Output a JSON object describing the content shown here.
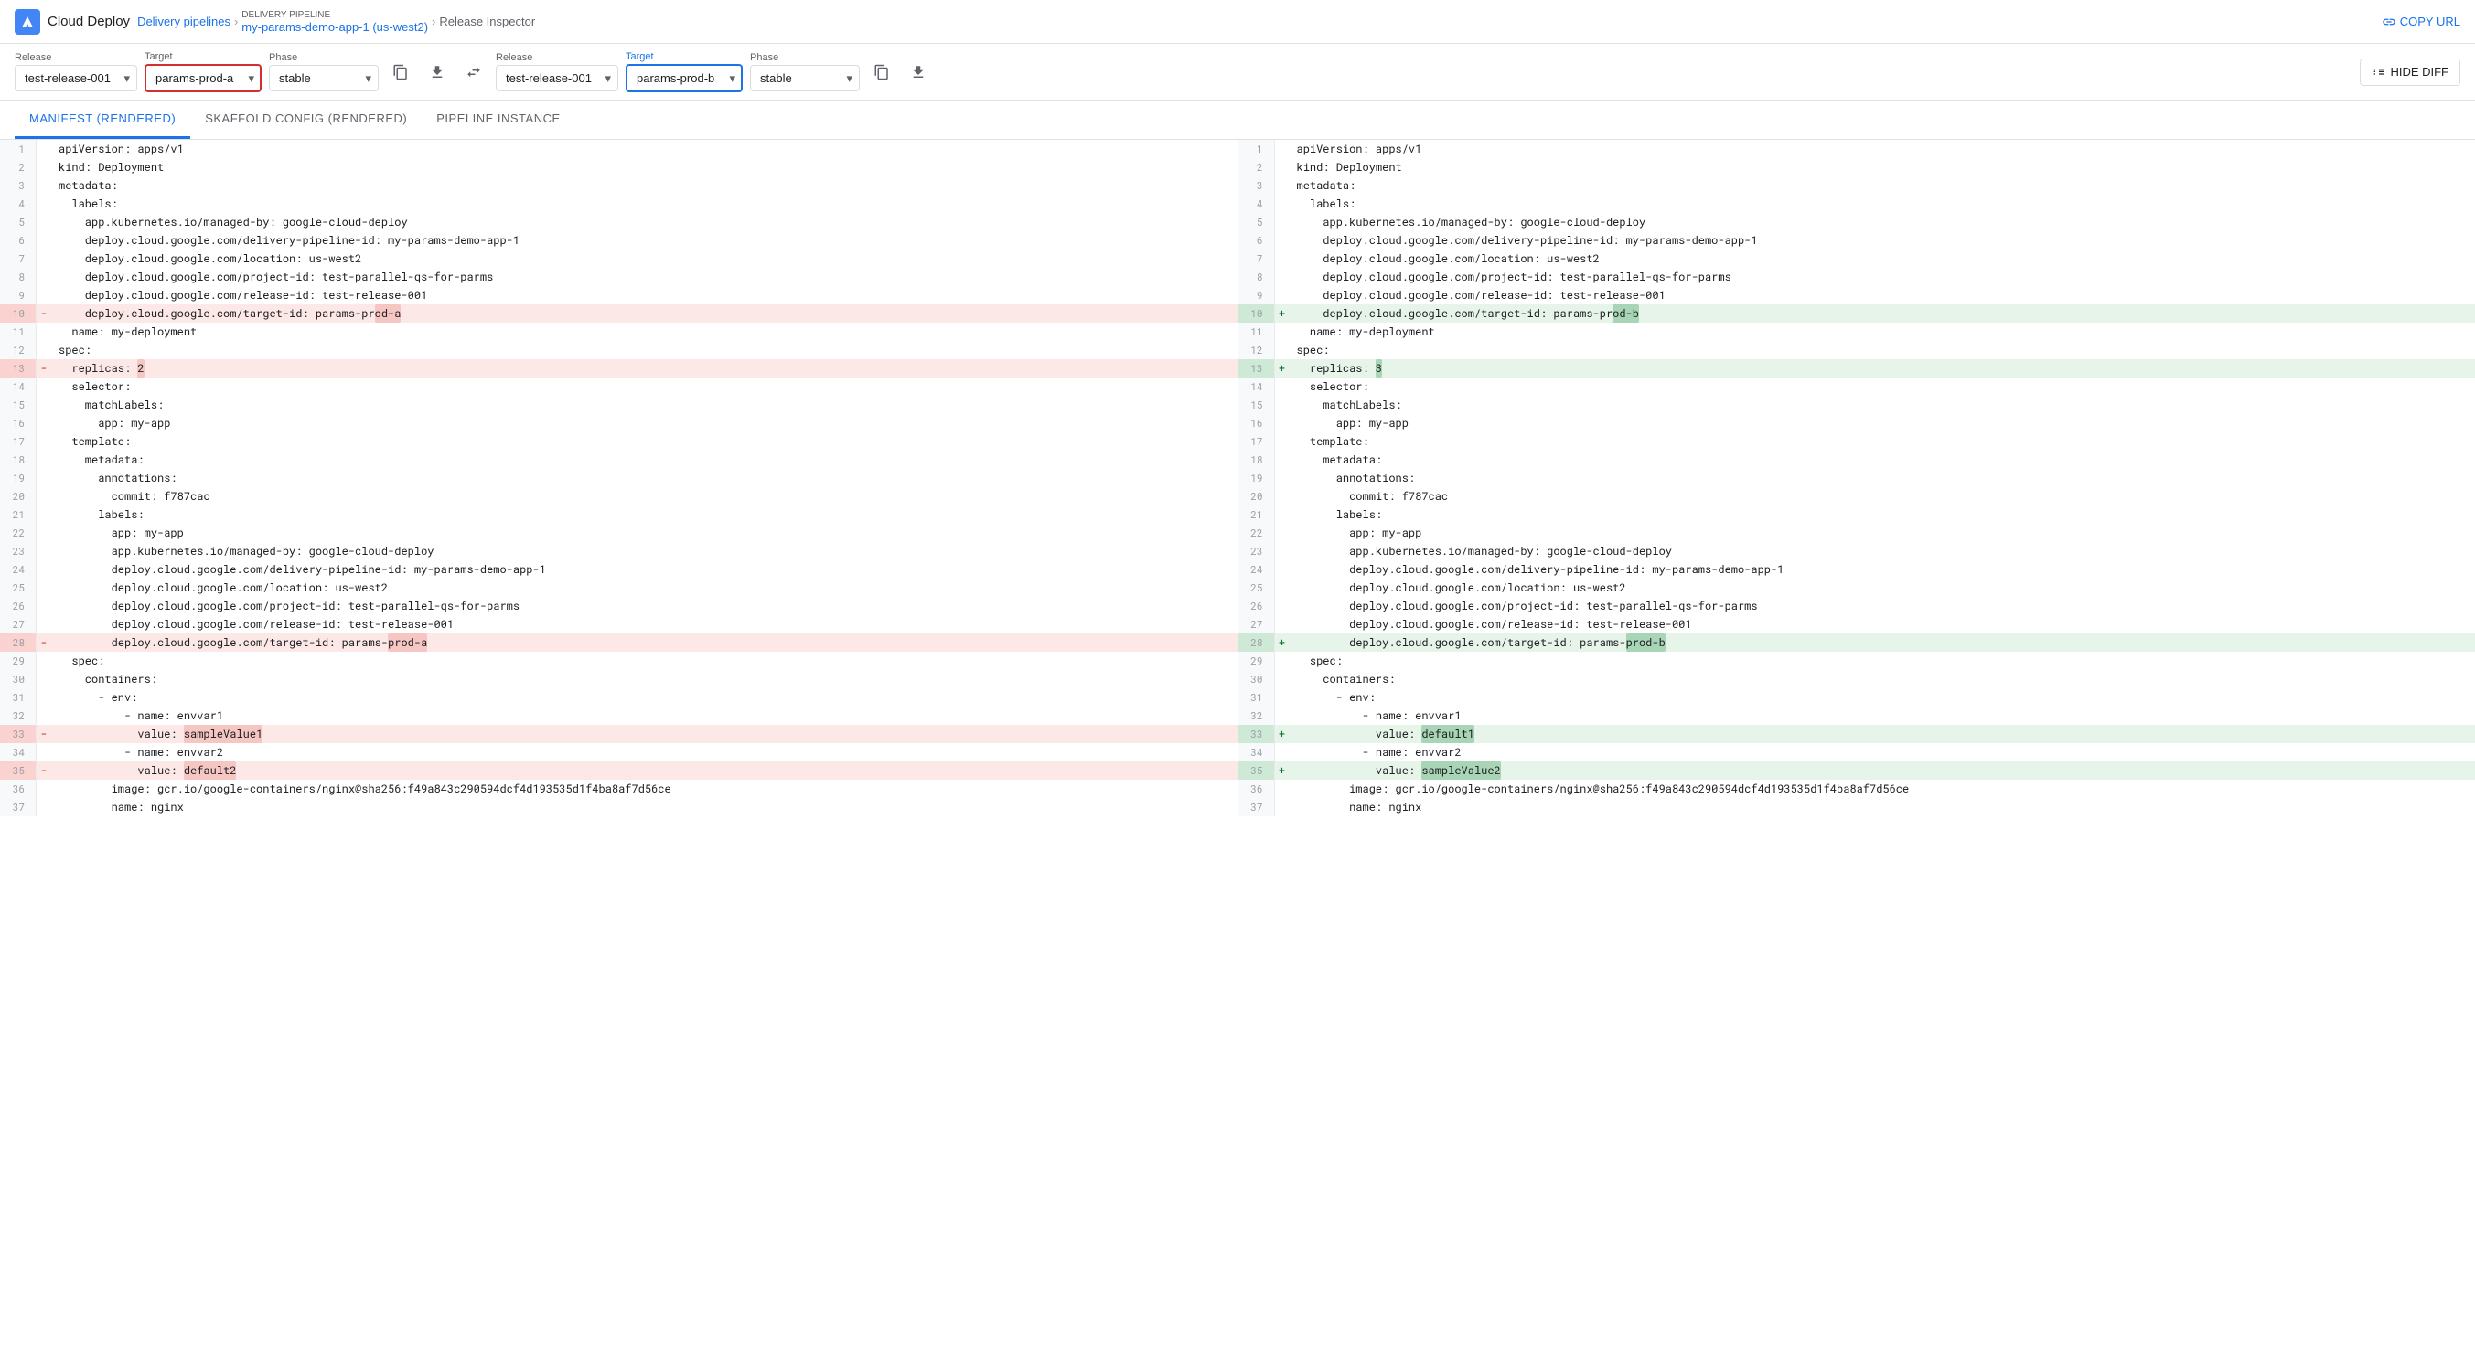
{
  "nav": {
    "logo_text": "Cloud Deploy",
    "breadcrumb": {
      "delivery_pipelines_label": "Delivery pipelines",
      "sep1": ">",
      "pipeline_meta_label": "DELIVERY PIPELINE",
      "pipeline_name": "my-params-demo-app-1 (us-west2)",
      "sep2": ">",
      "current": "Release Inspector"
    },
    "copy_url_label": "COPY URL"
  },
  "toolbar": {
    "left": {
      "release_label": "Release",
      "release_value": "test-release-001",
      "target_label": "Target",
      "target_value": "params-prod-a",
      "phase_label": "Phase",
      "phase_value": "stable"
    },
    "right": {
      "release_label": "Release",
      "release_value": "test-release-001",
      "target_label": "Target",
      "target_value": "params-prod-b",
      "phase_label": "Phase",
      "phase_value": "stable"
    },
    "hide_diff_label": "HIDE DIFF"
  },
  "tabs": [
    {
      "id": "manifest",
      "label": "MANIFEST (RENDERED)",
      "active": true
    },
    {
      "id": "skaffold",
      "label": "SKAFFOLD CONFIG (RENDERED)",
      "active": false
    },
    {
      "id": "pipeline",
      "label": "PIPELINE INSTANCE",
      "active": false
    }
  ],
  "left_lines": [
    {
      "num": 1,
      "type": "normal",
      "content": "apiVersion: apps/v1"
    },
    {
      "num": 2,
      "type": "normal",
      "content": "kind: Deployment"
    },
    {
      "num": 3,
      "type": "normal",
      "content": "metadata:"
    },
    {
      "num": 4,
      "type": "normal",
      "content": "  labels:"
    },
    {
      "num": 5,
      "type": "normal",
      "content": "    app.kubernetes.io/managed-by: google-cloud-deploy"
    },
    {
      "num": 6,
      "type": "normal",
      "content": "    deploy.cloud.google.com/delivery-pipeline-id: my-params-demo-app-1"
    },
    {
      "num": 7,
      "type": "normal",
      "content": "    deploy.cloud.google.com/location: us-west2"
    },
    {
      "num": 8,
      "type": "normal",
      "content": "    deploy.cloud.google.com/project-id: test-parallel-qs-for-parms"
    },
    {
      "num": 9,
      "type": "normal",
      "content": "    deploy.cloud.google.com/release-id: test-release-001"
    },
    {
      "num": 10,
      "type": "removed",
      "marker": "-",
      "content": "    deploy.cloud.google.com/target-id: params-prod-a",
      "highlight_start": 48,
      "highlight_end": 62
    },
    {
      "num": 11,
      "type": "normal",
      "content": "  name: my-deployment"
    },
    {
      "num": 12,
      "type": "normal",
      "content": "spec:"
    },
    {
      "num": 13,
      "type": "removed",
      "marker": "-",
      "content": "  replicas: 2",
      "highlight_start": 12,
      "highlight_end": 13
    },
    {
      "num": 14,
      "type": "normal",
      "content": "  selector:"
    },
    {
      "num": 15,
      "type": "normal",
      "content": "    matchLabels:"
    },
    {
      "num": 16,
      "type": "normal",
      "content": "      app: my-app"
    },
    {
      "num": 17,
      "type": "normal",
      "content": "  template:"
    },
    {
      "num": 18,
      "type": "normal",
      "content": "    metadata:"
    },
    {
      "num": 19,
      "type": "normal",
      "content": "      annotations:"
    },
    {
      "num": 20,
      "type": "normal",
      "content": "        commit: f787cac"
    },
    {
      "num": 21,
      "type": "normal",
      "content": "      labels:"
    },
    {
      "num": 22,
      "type": "normal",
      "content": "        app: my-app"
    },
    {
      "num": 23,
      "type": "normal",
      "content": "        app.kubernetes.io/managed-by: google-cloud-deploy"
    },
    {
      "num": 24,
      "type": "normal",
      "content": "        deploy.cloud.google.com/delivery-pipeline-id: my-params-demo-app-1"
    },
    {
      "num": 25,
      "type": "normal",
      "content": "        deploy.cloud.google.com/location: us-west2"
    },
    {
      "num": 26,
      "type": "normal",
      "content": "        deploy.cloud.google.com/project-id: test-parallel-qs-for-parms"
    },
    {
      "num": 27,
      "type": "normal",
      "content": "        deploy.cloud.google.com/release-id: test-release-001"
    },
    {
      "num": 28,
      "type": "removed",
      "marker": "-",
      "content": "        deploy.cloud.google.com/target-id: params-prod-a",
      "highlight_start": 50,
      "highlight_end": 62
    },
    {
      "num": 29,
      "type": "normal",
      "content": "  spec:"
    },
    {
      "num": 30,
      "type": "normal",
      "content": "    containers:"
    },
    {
      "num": 31,
      "type": "normal",
      "content": "      - env:"
    },
    {
      "num": 32,
      "type": "normal",
      "content": "          - name: envvar1"
    },
    {
      "num": 33,
      "type": "removed",
      "marker": "-",
      "content": "            value: sampleValue1",
      "highlight_start": 19,
      "highlight_end": 31
    },
    {
      "num": 34,
      "type": "normal",
      "content": "          - name: envvar2"
    },
    {
      "num": 35,
      "type": "removed",
      "marker": "-",
      "content": "            value: default2",
      "highlight_start": 19,
      "highlight_end": 27
    },
    {
      "num": 36,
      "type": "normal",
      "content": "        image: gcr.io/google-containers/nginx@sha256:f49a843c290594dcf4d193535d1f4ba8af7d56ce"
    },
    {
      "num": 37,
      "type": "normal",
      "content": "        name: nginx"
    }
  ],
  "right_lines": [
    {
      "num": 1,
      "type": "normal",
      "content": "apiVersion: apps/v1"
    },
    {
      "num": 2,
      "type": "normal",
      "content": "kind: Deployment"
    },
    {
      "num": 3,
      "type": "normal",
      "content": "metadata:"
    },
    {
      "num": 4,
      "type": "normal",
      "content": "  labels:"
    },
    {
      "num": 5,
      "type": "normal",
      "content": "    app.kubernetes.io/managed-by: google-cloud-deploy"
    },
    {
      "num": 6,
      "type": "normal",
      "content": "    deploy.cloud.google.com/delivery-pipeline-id: my-params-demo-app-1"
    },
    {
      "num": 7,
      "type": "normal",
      "content": "    deploy.cloud.google.com/location: us-west2"
    },
    {
      "num": 8,
      "type": "normal",
      "content": "    deploy.cloud.google.com/project-id: test-parallel-qs-for-parms"
    },
    {
      "num": 9,
      "type": "normal",
      "content": "    deploy.cloud.google.com/release-id: test-release-001"
    },
    {
      "num": 10,
      "type": "added",
      "marker": "+",
      "content": "    deploy.cloud.google.com/target-id: params-prod-b",
      "highlight_start": 48,
      "highlight_end": 62
    },
    {
      "num": 11,
      "type": "normal",
      "content": "  name: my-deployment"
    },
    {
      "num": 12,
      "type": "normal",
      "content": "spec:"
    },
    {
      "num": 13,
      "type": "added",
      "marker": "+",
      "content": "  replicas: 3",
      "highlight_start": 12,
      "highlight_end": 13
    },
    {
      "num": 14,
      "type": "normal",
      "content": "  selector:"
    },
    {
      "num": 15,
      "type": "normal",
      "content": "    matchLabels:"
    },
    {
      "num": 16,
      "type": "normal",
      "content": "      app: my-app"
    },
    {
      "num": 17,
      "type": "normal",
      "content": "  template:"
    },
    {
      "num": 18,
      "type": "normal",
      "content": "    metadata:"
    },
    {
      "num": 19,
      "type": "normal",
      "content": "      annotations:"
    },
    {
      "num": 20,
      "type": "normal",
      "content": "        commit: f787cac"
    },
    {
      "num": 21,
      "type": "normal",
      "content": "      labels:"
    },
    {
      "num": 22,
      "type": "normal",
      "content": "        app: my-app"
    },
    {
      "num": 23,
      "type": "normal",
      "content": "        app.kubernetes.io/managed-by: google-cloud-deploy"
    },
    {
      "num": 24,
      "type": "normal",
      "content": "        deploy.cloud.google.com/delivery-pipeline-id: my-params-demo-app-1"
    },
    {
      "num": 25,
      "type": "normal",
      "content": "        deploy.cloud.google.com/location: us-west2"
    },
    {
      "num": 26,
      "type": "normal",
      "content": "        deploy.cloud.google.com/project-id: test-parallel-qs-for-parms"
    },
    {
      "num": 27,
      "type": "normal",
      "content": "        deploy.cloud.google.com/release-id: test-release-001"
    },
    {
      "num": 28,
      "type": "added",
      "marker": "+",
      "content": "        deploy.cloud.google.com/target-id: params-prod-b",
      "highlight_start": 50,
      "highlight_end": 62
    },
    {
      "num": 29,
      "type": "normal",
      "content": "  spec:"
    },
    {
      "num": 30,
      "type": "normal",
      "content": "    containers:"
    },
    {
      "num": 31,
      "type": "normal",
      "content": "      - env:"
    },
    {
      "num": 32,
      "type": "normal",
      "content": "          - name: envvar1"
    },
    {
      "num": 33,
      "type": "added",
      "marker": "+",
      "content": "            value: default1",
      "highlight_start": 19,
      "highlight_end": 27
    },
    {
      "num": 34,
      "type": "normal",
      "content": "          - name: envvar2"
    },
    {
      "num": 35,
      "type": "added",
      "marker": "+",
      "content": "            value: sampleValue2",
      "highlight_start": 19,
      "highlight_end": 31
    },
    {
      "num": 36,
      "type": "normal",
      "content": "        image: gcr.io/google-containers/nginx@sha256:f49a843c290594dcf4d193535d1f4ba8af7d56ce"
    },
    {
      "num": 37,
      "type": "normal",
      "content": "        name: nginx"
    }
  ]
}
